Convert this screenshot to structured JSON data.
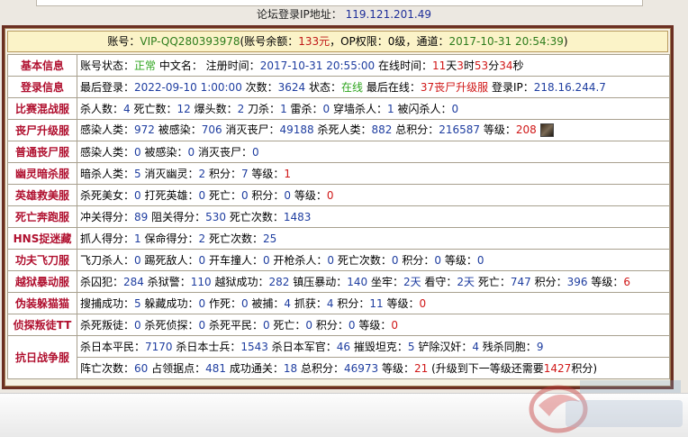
{
  "header": {
    "ip_label": "论坛登录IP地址：",
    "ip_value": "119.121.201.49"
  },
  "account": {
    "prefix": "账号：",
    "id": "VIP-QQ280393978",
    "balance_label": "(账号余额：",
    "balance": "133元",
    "op_label": "，OP权限：",
    "op": "0级",
    "channel_label": "，通道：",
    "channel_time": "2017-10-31 20:54:39",
    "suffix": ")"
  },
  "rows": {
    "basic": {
      "cat": "基本信息",
      "status_label": "账号状态：",
      "status": "正常",
      "cname_label": " 中文名：",
      "reg_label": " 注册时间：",
      "reg_time": "2017-10-31 20:55:00",
      "online_label": " 在线时间：",
      "d": "11",
      "d_u": "天",
      "h": "3",
      "h_u": "时",
      "m": "53",
      "m_u": "分",
      "s": "34",
      "s_u": "秒"
    },
    "login": {
      "cat": "登录信息",
      "last_label": "最后登录：",
      "last": "2022-09-10 1:00:00",
      "count_label": " 次数：",
      "count": "3624",
      "state_label": " 状态：",
      "state": "在线",
      "last_online_label": " 最后在线：",
      "last_online": "37丧尸升级服",
      "lip_label": " 登录IP：",
      "lip": "218.16.244.7"
    },
    "match": {
      "cat": "比赛混战服",
      "k_label": "杀人数：",
      "k": "4",
      "d_label": " 死亡数：",
      "d": "12",
      "hs_label": " 爆头数：",
      "hs": "2",
      "kn_label": " 刀杀：",
      "kn": "1",
      "th_label": " 雷杀：",
      "th": "0",
      "wall_label": " 穿墙杀人：",
      "wall": "1",
      "flash_label": " 被闪杀人：",
      "flash": "0"
    },
    "zombie": {
      "cat": "丧尸升级服",
      "inf_label": "感染人类：",
      "inf": "972",
      "infd_label": " 被感染：",
      "infd": "706",
      "kz_label": " 消灭丧尸：",
      "kz": "49188",
      "kh_label": " 杀死人类：",
      "kh": "882",
      "pts_label": " 总积分：",
      "pts": "216587",
      "lvl_label": " 等级：",
      "lvl": "208"
    },
    "normal_zombie": {
      "cat": "普通丧尸服",
      "inf_label": "感染人类：",
      "inf": "0",
      "infd_label": " 被感染：",
      "infd": "0",
      "kz_label": " 消灭丧尸：",
      "kz": "0"
    },
    "ghost": {
      "cat": "幽灵暗杀服",
      "a_label": "暗杀人类：",
      "a": "5",
      "b_label": " 消灭幽灵：",
      "b": "2",
      "p_label": " 积分：",
      "p": "7",
      "l_label": " 等级：",
      "l": "1"
    },
    "hero": {
      "cat": "英雄救美服",
      "a_label": "杀死美女：",
      "a": "0",
      "b_label": " 打死英雄：",
      "b": "0",
      "c_label": " 死亡：",
      "c": "0",
      "p_label": " 积分：",
      "p": "0",
      "l_label": " 等级：",
      "l": "0"
    },
    "death_run": {
      "cat": "死亡奔跑服",
      "a_label": "冲关得分：",
      "a": "89",
      "b_label": " 阻关得分：",
      "b": "530",
      "c_label": " 死亡次数：",
      "c": "1483"
    },
    "hns": {
      "cat": "HNS捉迷藏",
      "a_label": "抓人得分：",
      "a": "1",
      "b_label": " 保命得分：",
      "b": "2",
      "c_label": " 死亡次数：",
      "c": "25"
    },
    "kungfu": {
      "cat": "功夫飞刀服",
      "a_label": "飞刀杀人：",
      "a": "0",
      "b_label": " 踢死敌人：",
      "b": "0",
      "c_label": " 开车撞人：",
      "c": "0",
      "d_label": " 开枪杀人：",
      "d": "0",
      "e_label": " 死亡次数：",
      "e": "0",
      "p_label": " 积分：",
      "p": "0",
      "l_label": " 等级：",
      "l": "0"
    },
    "jail": {
      "cat": "越狱暴动服",
      "a_label": "杀囚犯：",
      "a": "284",
      "b_label": " 杀狱警：",
      "b": "110",
      "c_label": " 越狱成功：",
      "c": "282",
      "d_label": " 镇压暴动：",
      "d": "140",
      "e_label": " 坐牢：",
      "e": "2天",
      "f_label": " 看守：",
      "f": "2天",
      "g_label": " 死亡：",
      "g": "747",
      "p_label": " 积分：",
      "p": "396",
      "l_label": " 等级：",
      "l": "6"
    },
    "prop": {
      "cat": "伪装躲猫猫",
      "a_label": "搜捕成功：",
      "a": "5",
      "b_label": " 躲藏成功：",
      "b": "0",
      "c_label": " 作死：",
      "c": "0",
      "d_label": " 被捕：",
      "d": "4",
      "e_label": " 抓获：",
      "e": "4",
      "p_label": " 积分：",
      "p": "11",
      "l_label": " 等级：",
      "l": "0"
    },
    "tt": {
      "cat": "侦探叛徒TT",
      "a_label": "杀死叛徒：",
      "a": "0",
      "b_label": " 杀死侦探：",
      "b": "0",
      "c_label": " 杀死平民：",
      "c": "0",
      "d_label": " 死亡：",
      "d": "0",
      "p_label": " 积分：",
      "p": "0",
      "l_label": " 等级：",
      "l": "0"
    },
    "war": {
      "cat": "抗日战争服",
      "a_label": "杀日本平民：",
      "a": "7170",
      "b_label": " 杀日本士兵：",
      "b": "1543",
      "c_label": " 杀日本军官：",
      "c": "46",
      "d_label": " 摧毁坦克：",
      "d": "5",
      "e_label": " 铲除汉奸：",
      "e": "4",
      "f_label": " 残杀同胞：",
      "f": "9",
      "g_label": "阵亡次数：",
      "g": "60",
      "h_label": " 占领据点：",
      "h": "481",
      "i_label": " 成功通关：",
      "i": "18",
      "p_label": " 总积分：",
      "p": "46973",
      "l_label": " 等级：",
      "l": "21",
      "note_a": " (升级到下一等级还需要",
      "note_b": "1427",
      "note_c": "积分)"
    }
  }
}
